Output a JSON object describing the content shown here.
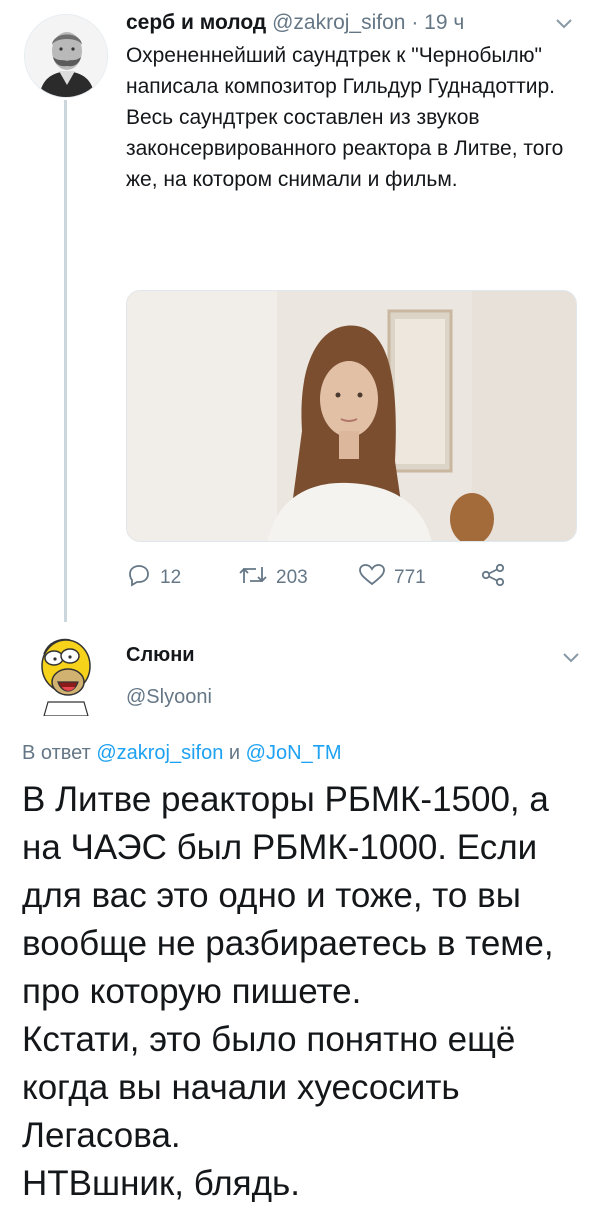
{
  "tweet1": {
    "author_name": "серб и молод",
    "handle": "@zakroj_sifon",
    "dot": "·",
    "time": "19 ч",
    "text": "Охрененнейший саундтрек к \"Чернобылю\" написала композитор Гильдур Гуднадоттир. Весь саундтрек составлен из звуков законсервированного реактора в Литве, того же, на котором снимали и фильм.",
    "actions": {
      "replies": "12",
      "retweets": "203",
      "likes": "771"
    }
  },
  "tweet2": {
    "author_name": "Слюни",
    "handle": "@Slyooni",
    "reply_prefix": "В ответ",
    "reply_to_1": "@zakroj_sifon",
    "reply_and": "и",
    "reply_to_2": "@JoN_TM",
    "text": "В Литве реакторы РБМК-1500, а на ЧАЭС был РБМК-1000. Если для вас это одно и тоже, то вы вообще не разбираетесь в теме, про которую пишете.\nКстати, это было понятно ещё когда вы начали хуесосить Легасова.\nНТВшник, блядь."
  },
  "icons": {
    "reply": "reply-icon",
    "retweet": "retweet-icon",
    "like": "heart-icon",
    "share": "share-icon",
    "more": "chevron-down-icon"
  },
  "colors": {
    "text": "#14171a",
    "secondary": "#657786",
    "link": "#1da1f2",
    "thread_line": "#ccd6dd"
  }
}
